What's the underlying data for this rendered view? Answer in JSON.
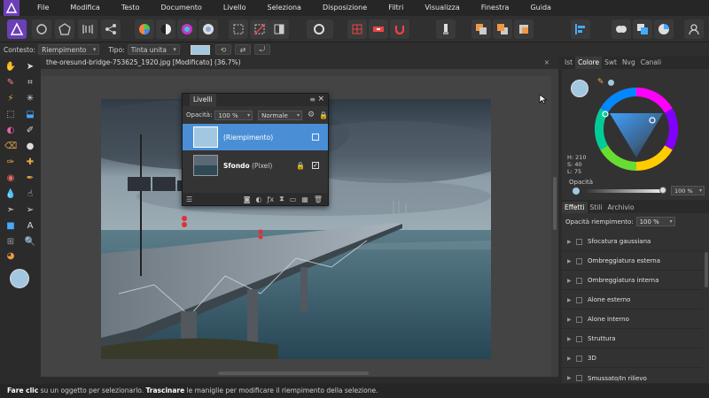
{
  "menu": {
    "items": [
      "File",
      "Modifica",
      "Testo",
      "Documento",
      "Livello",
      "Seleziona",
      "Disposizione",
      "Filtri",
      "Visualizza",
      "Finestra",
      "Guida"
    ]
  },
  "context": {
    "label_context": "Contesto:",
    "context_value": "Riempimento",
    "label_type": "Tipo:",
    "type_value": "Tinta unita",
    "fill_color": "#a1c8e0"
  },
  "document": {
    "tab_title": "the-oresund-bridge-753625_1920.jpg [Modificato] (36.7%)",
    "close_glyph": "×"
  },
  "layers_panel": {
    "title": "Livelli",
    "opacity_label": "Opacità:",
    "opacity_value": "100 %",
    "blend_mode": "Normale",
    "layers": [
      {
        "name": "(Riempimento)",
        "bold": false
      },
      {
        "name": "Sfondo",
        "suffix": "(Pixel)",
        "bold": true
      }
    ]
  },
  "right_top": {
    "tabs": [
      "Ist",
      "Colore",
      "Swt",
      "Nvg",
      "Canali"
    ],
    "active_tab": "Colore",
    "h_label": "H: 210",
    "s_label": "S: 40",
    "l_label": "L: 75",
    "opacity_label": "Opacità",
    "opacity_value": "100 %",
    "color": "#a1c8e0"
  },
  "right_bottom": {
    "tabs": [
      "Effetti",
      "Stili",
      "Archivio"
    ],
    "active_tab": "Effetti",
    "fill_opacity_label": "Opacità riempimento:",
    "fill_opacity_value": "100 %",
    "effects": [
      "Sfocatura gaussiana",
      "Ombreggiatura esterna",
      "Ombreggiatura interna",
      "Alone esterno",
      "Alone interno",
      "Struttura",
      "3D",
      "Smussato/In rilievo"
    ]
  },
  "status": {
    "part1_bold": "Fare clic",
    "part2": " su un oggetto per selezionarlo. ",
    "part3_bold": "Trascinare",
    "part4": " le maniglie per modificare il riempimento della selezione."
  },
  "icons": {
    "app_logo": "affinity-photo-logo-icon",
    "user": "user-icon"
  }
}
